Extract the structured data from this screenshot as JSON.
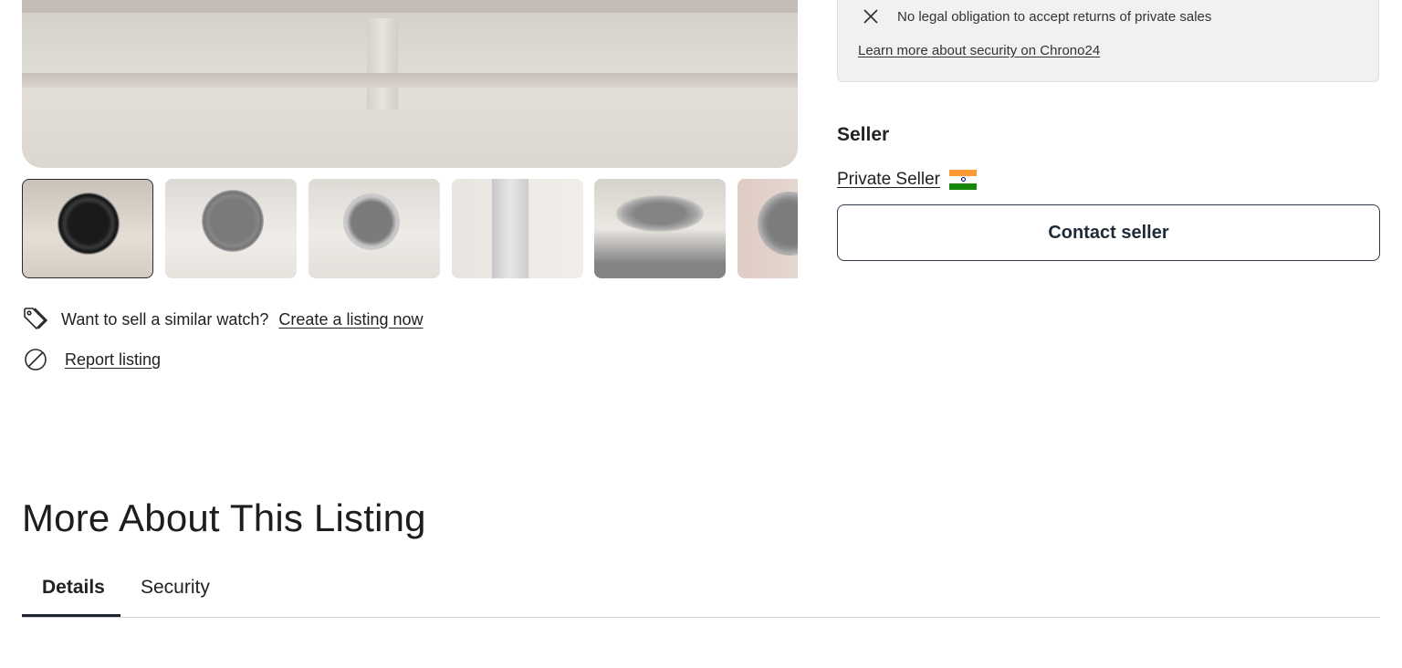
{
  "gallery": {
    "thumbnail_count": 6,
    "active_index": 0
  },
  "actions": {
    "sell_prompt": "Want to sell a similar watch?",
    "create_listing_link": "Create a listing now",
    "report_link": "Report listing"
  },
  "security_box": {
    "item_text": "No legal obligation to accept returns of private sales",
    "learn_more_link": "Learn more about security on Chrono24"
  },
  "seller": {
    "heading": "Seller",
    "name_link": "Private Seller",
    "flag_icon": "india-flag-icon",
    "contact_button": "Contact seller"
  },
  "more_about": {
    "heading": "More About This Listing",
    "tabs": [
      {
        "label": "Details",
        "active": true
      },
      {
        "label": "Security",
        "active": false
      }
    ]
  },
  "colors": {
    "accent_dark": "#1d2433",
    "panel_bg": "#f1f1f1",
    "flag_saffron": "#ff9933",
    "flag_green": "#138808"
  }
}
